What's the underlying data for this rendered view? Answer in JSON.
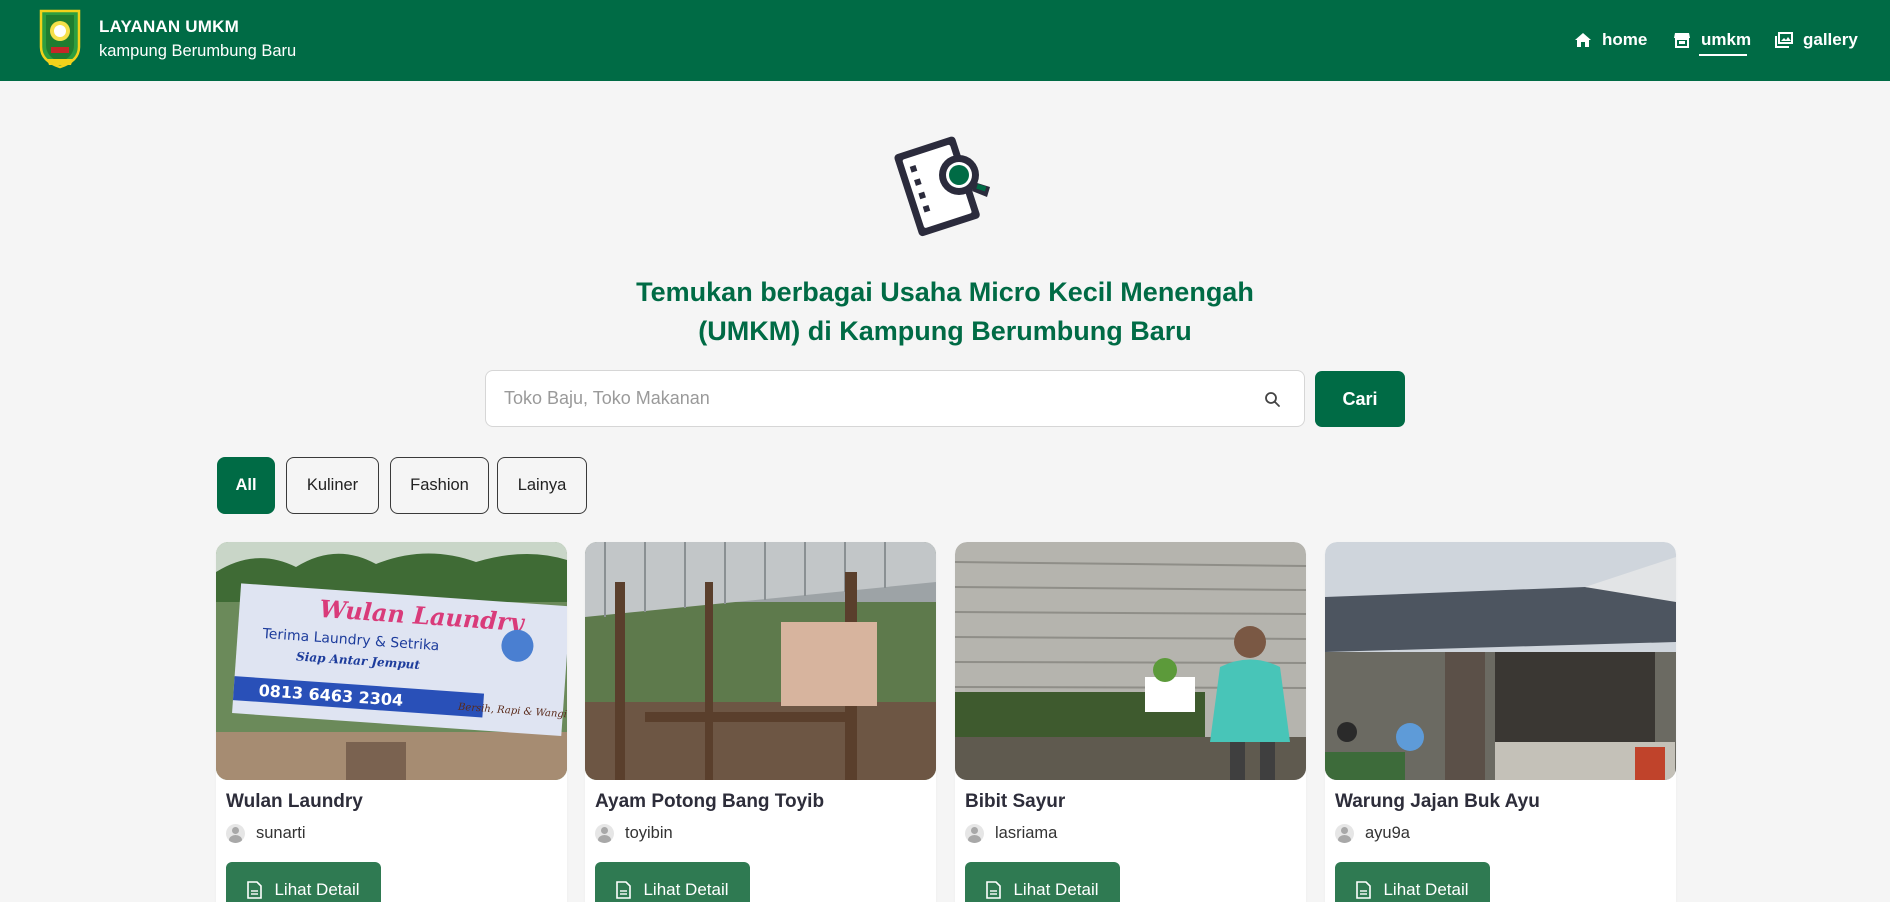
{
  "brand": {
    "title": "LAYANAN UMKM",
    "subtitle": "kampung Berumbung Baru"
  },
  "nav": [
    {
      "label": "home",
      "icon": "home-icon"
    },
    {
      "label": "umkm",
      "icon": "store-icon",
      "active": true
    },
    {
      "label": "gallery",
      "icon": "images-icon"
    }
  ],
  "hero": {
    "icon": "document-search-icon",
    "title_line1": "Temukan berbagai Usaha Micro Kecil Menengah",
    "title_line2": "(UMKM) di Kampung Berumbung Baru"
  },
  "search": {
    "placeholder": "Toko Baju, Toko Makanan",
    "value": "",
    "button_label": "Cari"
  },
  "filters": [
    {
      "label": "All",
      "active": true
    },
    {
      "label": "Kuliner",
      "active": false
    },
    {
      "label": "Fashion",
      "active": false
    },
    {
      "label": "Lainya",
      "active": false
    }
  ],
  "cards": [
    {
      "title": "Wulan Laundry",
      "owner": "sunarti",
      "button_label": "Lihat Detail"
    },
    {
      "title": "Ayam Potong Bang Toyib",
      "owner": "toyibin",
      "button_label": "Lihat Detail"
    },
    {
      "title": "Bibit Sayur",
      "owner": "lasriama",
      "button_label": "Lihat Detail"
    },
    {
      "title": "Warung Jajan Buk Ayu",
      "owner": "ayu9a",
      "button_label": "Lihat Detail"
    }
  ],
  "banner_text": {
    "name": "Wulan Laundry",
    "line1": "Terima Laundry & Setrika",
    "line2": "Siap Antar Jemput",
    "phone": "0813 6463 2304",
    "tagline": "Bersih, Rapi & Wangi"
  },
  "colors": {
    "primary": "#006b45",
    "button": "#2f7a52",
    "background": "#f5f5f5"
  }
}
